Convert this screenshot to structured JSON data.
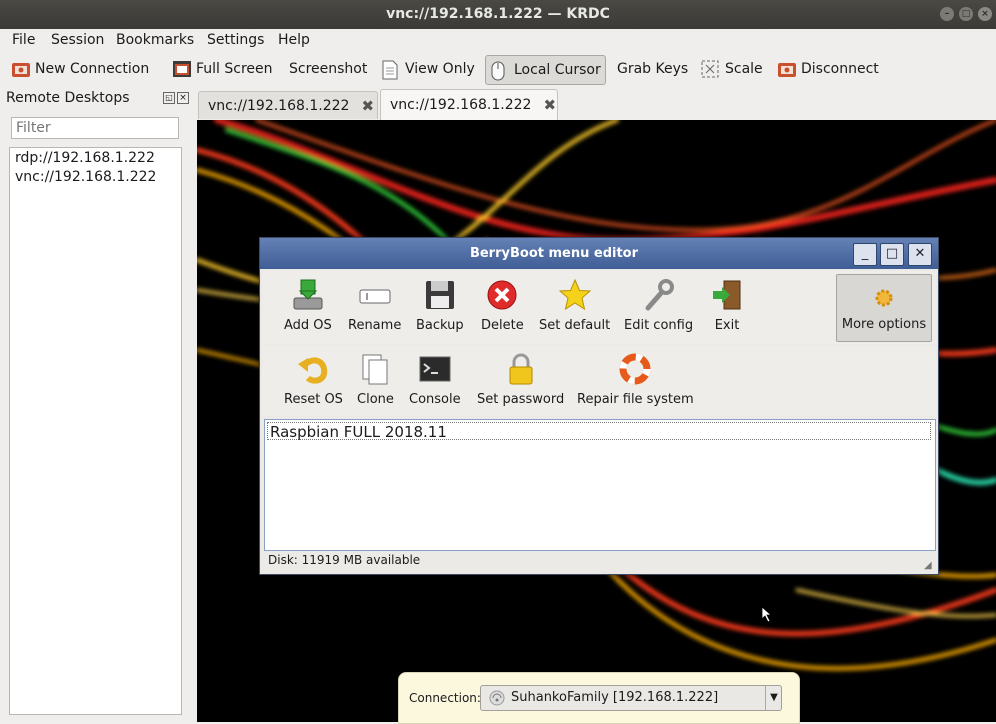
{
  "window": {
    "title": "vnc://192.168.1.222 — KRDC",
    "minimize": "–",
    "maximize": "□",
    "close": "×"
  },
  "menu": [
    "File",
    "Session",
    "Bookmarks",
    "Settings",
    "Help"
  ],
  "toolbar": {
    "new_connection": "New Connection",
    "full_screen": "Full Screen",
    "screenshot": "Screenshot",
    "view_only": "View Only",
    "local_cursor": "Local Cursor",
    "grab_keys": "Grab Keys",
    "scale": "Scale",
    "disconnect": "Disconnect"
  },
  "dock": {
    "title": "Remote Desktops",
    "filter_placeholder": "Filter",
    "items": [
      "rdp://192.168.1.222",
      "vnc://192.168.1.222"
    ]
  },
  "tabs": [
    {
      "label": "vnc://192.168.1.222",
      "close": "✖"
    },
    {
      "label": "vnc://192.168.1.222",
      "close": "✖"
    }
  ],
  "dialog": {
    "title": "BerryBoot menu editor",
    "minimize": "_",
    "maximize": "□",
    "close": "✕",
    "row1": [
      "Add OS",
      "Rename",
      "Backup",
      "Delete",
      "Set default",
      "Edit config",
      "Exit"
    ],
    "more_options": "More options",
    "row2": [
      "Reset OS",
      "Clone",
      "Console",
      "Set password",
      "Repair file system"
    ],
    "os_list": [
      "Raspbian FULL 2018.11"
    ],
    "status": "Disk: 11919 MB available"
  },
  "connection_bar": {
    "label": "Connection:",
    "network": "SuhankoFamily [192.168.1.222]"
  },
  "icons": {
    "add_os": "download-disk-icon",
    "rename": "rename-field-icon",
    "backup": "floppy-disk-icon",
    "delete": "delete-icon",
    "set_default": "star-icon",
    "edit_config": "wrench-icon",
    "exit": "exit-door-icon",
    "more_options": "gear-icon",
    "reset_os": "undo-arrow-icon",
    "clone": "copy-pages-icon",
    "console": "terminal-icon",
    "set_password": "padlock-icon",
    "repair": "lifebuoy-icon",
    "network": "wifi-icon"
  },
  "colors": {
    "dialog_titlebar": "#4a6aa5",
    "window_titlebar": "#3f3e3a",
    "connection_bar": "#fbf8de",
    "remote_background": "#000000"
  }
}
